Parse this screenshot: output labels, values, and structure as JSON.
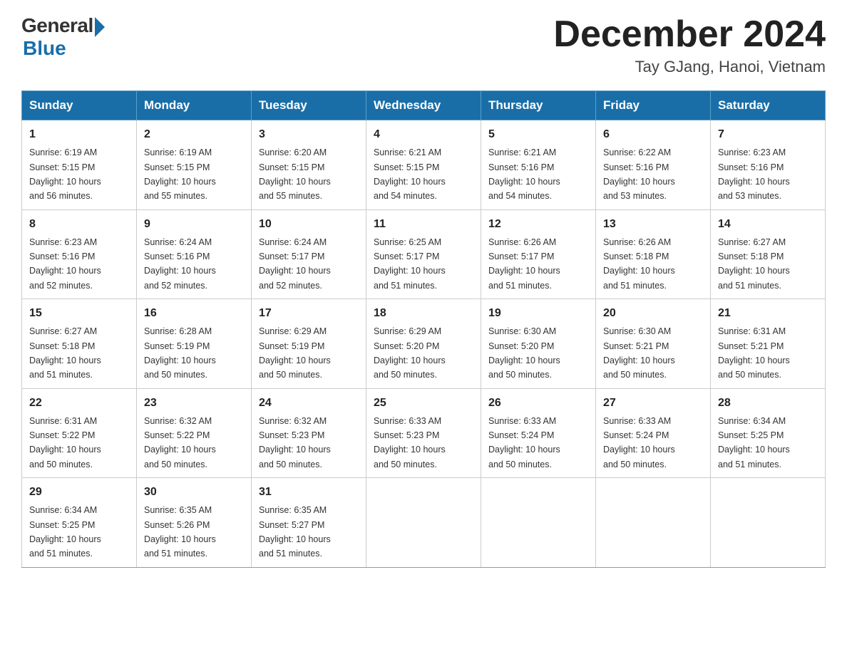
{
  "logo": {
    "general": "General",
    "blue": "Blue"
  },
  "title": "December 2024",
  "location": "Tay GJang, Hanoi, Vietnam",
  "days_of_week": [
    "Sunday",
    "Monday",
    "Tuesday",
    "Wednesday",
    "Thursday",
    "Friday",
    "Saturday"
  ],
  "weeks": [
    [
      {
        "day": "1",
        "sunrise": "6:19 AM",
        "sunset": "5:15 PM",
        "daylight": "10 hours and 56 minutes."
      },
      {
        "day": "2",
        "sunrise": "6:19 AM",
        "sunset": "5:15 PM",
        "daylight": "10 hours and 55 minutes."
      },
      {
        "day": "3",
        "sunrise": "6:20 AM",
        "sunset": "5:15 PM",
        "daylight": "10 hours and 55 minutes."
      },
      {
        "day": "4",
        "sunrise": "6:21 AM",
        "sunset": "5:15 PM",
        "daylight": "10 hours and 54 minutes."
      },
      {
        "day": "5",
        "sunrise": "6:21 AM",
        "sunset": "5:16 PM",
        "daylight": "10 hours and 54 minutes."
      },
      {
        "day": "6",
        "sunrise": "6:22 AM",
        "sunset": "5:16 PM",
        "daylight": "10 hours and 53 minutes."
      },
      {
        "day": "7",
        "sunrise": "6:23 AM",
        "sunset": "5:16 PM",
        "daylight": "10 hours and 53 minutes."
      }
    ],
    [
      {
        "day": "8",
        "sunrise": "6:23 AM",
        "sunset": "5:16 PM",
        "daylight": "10 hours and 52 minutes."
      },
      {
        "day": "9",
        "sunrise": "6:24 AM",
        "sunset": "5:16 PM",
        "daylight": "10 hours and 52 minutes."
      },
      {
        "day": "10",
        "sunrise": "6:24 AM",
        "sunset": "5:17 PM",
        "daylight": "10 hours and 52 minutes."
      },
      {
        "day": "11",
        "sunrise": "6:25 AM",
        "sunset": "5:17 PM",
        "daylight": "10 hours and 51 minutes."
      },
      {
        "day": "12",
        "sunrise": "6:26 AM",
        "sunset": "5:17 PM",
        "daylight": "10 hours and 51 minutes."
      },
      {
        "day": "13",
        "sunrise": "6:26 AM",
        "sunset": "5:18 PM",
        "daylight": "10 hours and 51 minutes."
      },
      {
        "day": "14",
        "sunrise": "6:27 AM",
        "sunset": "5:18 PM",
        "daylight": "10 hours and 51 minutes."
      }
    ],
    [
      {
        "day": "15",
        "sunrise": "6:27 AM",
        "sunset": "5:18 PM",
        "daylight": "10 hours and 51 minutes."
      },
      {
        "day": "16",
        "sunrise": "6:28 AM",
        "sunset": "5:19 PM",
        "daylight": "10 hours and 50 minutes."
      },
      {
        "day": "17",
        "sunrise": "6:29 AM",
        "sunset": "5:19 PM",
        "daylight": "10 hours and 50 minutes."
      },
      {
        "day": "18",
        "sunrise": "6:29 AM",
        "sunset": "5:20 PM",
        "daylight": "10 hours and 50 minutes."
      },
      {
        "day": "19",
        "sunrise": "6:30 AM",
        "sunset": "5:20 PM",
        "daylight": "10 hours and 50 minutes."
      },
      {
        "day": "20",
        "sunrise": "6:30 AM",
        "sunset": "5:21 PM",
        "daylight": "10 hours and 50 minutes."
      },
      {
        "day": "21",
        "sunrise": "6:31 AM",
        "sunset": "5:21 PM",
        "daylight": "10 hours and 50 minutes."
      }
    ],
    [
      {
        "day": "22",
        "sunrise": "6:31 AM",
        "sunset": "5:22 PM",
        "daylight": "10 hours and 50 minutes."
      },
      {
        "day": "23",
        "sunrise": "6:32 AM",
        "sunset": "5:22 PM",
        "daylight": "10 hours and 50 minutes."
      },
      {
        "day": "24",
        "sunrise": "6:32 AM",
        "sunset": "5:23 PM",
        "daylight": "10 hours and 50 minutes."
      },
      {
        "day": "25",
        "sunrise": "6:33 AM",
        "sunset": "5:23 PM",
        "daylight": "10 hours and 50 minutes."
      },
      {
        "day": "26",
        "sunrise": "6:33 AM",
        "sunset": "5:24 PM",
        "daylight": "10 hours and 50 minutes."
      },
      {
        "day": "27",
        "sunrise": "6:33 AM",
        "sunset": "5:24 PM",
        "daylight": "10 hours and 50 minutes."
      },
      {
        "day": "28",
        "sunrise": "6:34 AM",
        "sunset": "5:25 PM",
        "daylight": "10 hours and 51 minutes."
      }
    ],
    [
      {
        "day": "29",
        "sunrise": "6:34 AM",
        "sunset": "5:25 PM",
        "daylight": "10 hours and 51 minutes."
      },
      {
        "day": "30",
        "sunrise": "6:35 AM",
        "sunset": "5:26 PM",
        "daylight": "10 hours and 51 minutes."
      },
      {
        "day": "31",
        "sunrise": "6:35 AM",
        "sunset": "5:27 PM",
        "daylight": "10 hours and 51 minutes."
      },
      null,
      null,
      null,
      null
    ]
  ],
  "labels": {
    "sunrise": "Sunrise:",
    "sunset": "Sunset:",
    "daylight": "Daylight:"
  }
}
